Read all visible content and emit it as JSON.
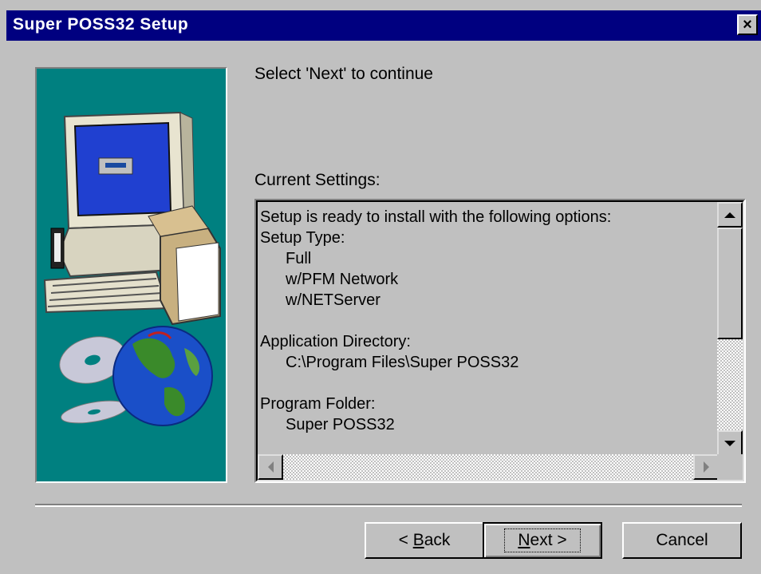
{
  "window": {
    "title": "Super POSS32 Setup",
    "close_label": "×"
  },
  "instruction": "Select 'Next' to continue",
  "current_settings_label": "Current Settings:",
  "settings": {
    "lines": [
      {
        "text": "Setup is ready to install with the following options:",
        "indent": false
      },
      {
        "text": "Setup Type:",
        "indent": false
      },
      {
        "text": "Full",
        "indent": true
      },
      {
        "text": "w/PFM Network",
        "indent": true
      },
      {
        "text": "w/NETServer",
        "indent": true
      },
      {
        "text": "",
        "indent": false
      },
      {
        "text": "Application Directory:",
        "indent": false
      },
      {
        "text": "C:\\Program Files\\Super POSS32",
        "indent": true
      },
      {
        "text": "",
        "indent": false
      },
      {
        "text": "Program Folder:",
        "indent": false
      },
      {
        "text": "Super POSS32",
        "indent": true
      }
    ]
  },
  "buttons": {
    "back": {
      "prefix": "< ",
      "mnemonic": "B",
      "rest": "ack"
    },
    "next": {
      "mnemonic": "N",
      "rest": "ext >"
    },
    "cancel": "Cancel"
  },
  "colors": {
    "titlebar": "#000080",
    "face": "#c0c0c0",
    "graphic_bg": "#008080"
  },
  "icons": [
    "close-icon",
    "computer-illustration",
    "cd-icon",
    "globe-icon",
    "scroll-up-arrow-icon",
    "scroll-down-arrow-icon",
    "scroll-left-arrow-icon",
    "scroll-right-arrow-icon"
  ]
}
